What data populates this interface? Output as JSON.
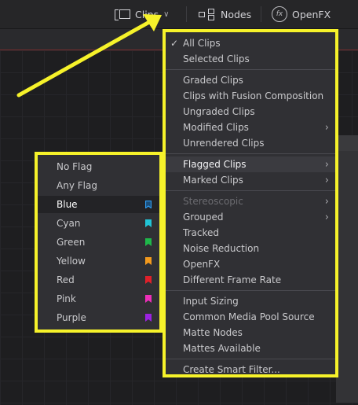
{
  "toolbar": {
    "clips_label": "Clips",
    "nodes_label": "Nodes",
    "openfx_label": "OpenFX",
    "fx_glyph": "fx",
    "chevron": "∨"
  },
  "filter_menu": {
    "groups": [
      [
        {
          "label": "All Clips",
          "checked": true
        },
        {
          "label": "Selected Clips"
        }
      ],
      [
        {
          "label": "Graded Clips"
        },
        {
          "label": "Clips with Fusion Composition"
        },
        {
          "label": "Ungraded Clips"
        },
        {
          "label": "Modified Clips",
          "submenu": true
        },
        {
          "label": "Unrendered Clips"
        }
      ],
      [
        {
          "label": "Flagged Clips",
          "submenu": true,
          "highlighted": true
        },
        {
          "label": "Marked Clips",
          "submenu": true
        }
      ],
      [
        {
          "label": "Stereoscopic",
          "submenu": true,
          "disabled": true
        },
        {
          "label": "Grouped",
          "submenu": true
        },
        {
          "label": "Tracked"
        },
        {
          "label": "Noise Reduction"
        },
        {
          "label": "OpenFX"
        },
        {
          "label": "Different Frame Rate"
        }
      ],
      [
        {
          "label": "Input Sizing"
        },
        {
          "label": "Common Media Pool Source"
        },
        {
          "label": "Matte Nodes"
        },
        {
          "label": "Mattes Available"
        }
      ],
      [
        {
          "label": "Create Smart Filter..."
        }
      ]
    ]
  },
  "flag_submenu": {
    "items": [
      {
        "label": "No Flag"
      },
      {
        "label": "Any Flag"
      },
      {
        "label": "Blue",
        "color": "#2f9bf0",
        "highlighted": true
      },
      {
        "label": "Cyan",
        "color": "#21c4d6"
      },
      {
        "label": "Green",
        "color": "#1fb84a"
      },
      {
        "label": "Yellow",
        "color": "#f39a1d"
      },
      {
        "label": "Red",
        "color": "#e0202a"
      },
      {
        "label": "Pink",
        "color": "#ec2fb8"
      },
      {
        "label": "Purple",
        "color": "#9b22e0"
      }
    ]
  },
  "colors": {
    "annotation": "#f6f22a"
  }
}
